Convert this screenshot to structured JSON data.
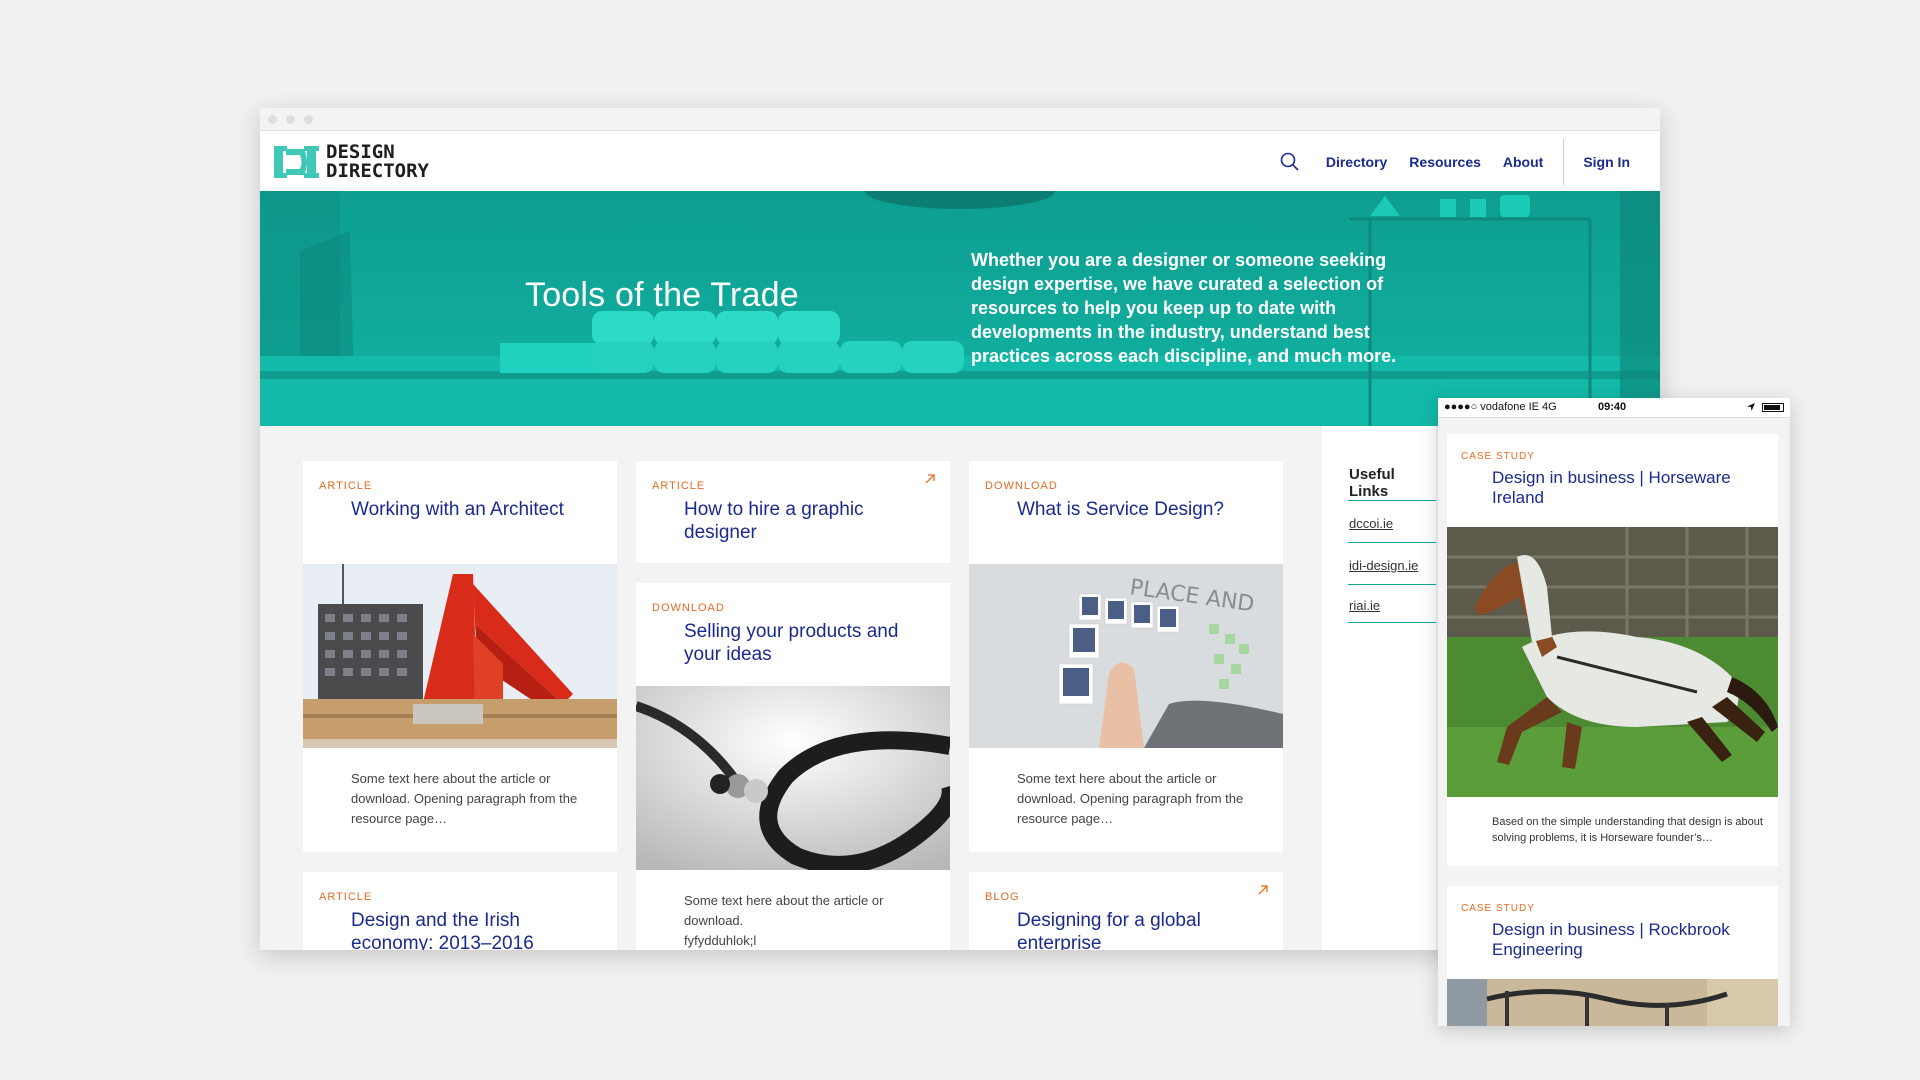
{
  "brand": {
    "logo_line1": "DESIGN",
    "logo_line2": "DIRECTORY",
    "accent": "#0fa596",
    "link_color": "#1b2a8f",
    "category_color": "#e56b21"
  },
  "nav": {
    "items": [
      "Directory",
      "Resources",
      "About"
    ],
    "sign_in": "Sign In"
  },
  "hero": {
    "title": "Tools of the Trade",
    "text": "Whether you are a designer or someone seeking design expertise, we have curated a selection of resources to help you keep up to date with developments in the industry, understand best practices across each discipline, and much more."
  },
  "cards": [
    {
      "category": "ARTICLE",
      "title": "Working with an Architect",
      "excerpt": "Some text here about the article or download. Opening paragraph from the resource page…",
      "image": "red-staircase-building-photo"
    },
    {
      "category": "ARTICLE",
      "title": "How to hire a graphic designer",
      "external": true
    },
    {
      "category": "DOWNLOAD",
      "title": "Selling your products and your ideas",
      "excerpt": "Some text here about the article or download.",
      "excerpt2": "fyfydduhlok;l",
      "image": "black-cord-necklace-photo"
    },
    {
      "category": "DOWNLOAD",
      "title": "What is Service Design?",
      "excerpt": "Some text here about the article or download. Opening paragraph from the resource page…",
      "image": "wall-sketches-photo"
    },
    {
      "category": "ARTICLE",
      "title": "Design and the Irish economy: 2013–2016"
    },
    {
      "category": "BLOG",
      "title": "Designing for a global enterprise",
      "external": true
    }
  ],
  "useful_links": {
    "heading": "Useful Links",
    "items": [
      "dccoi.ie",
      "idi-design.ie",
      "riai.ie"
    ]
  },
  "mobile": {
    "carrier": "●●●●○ vodafone IE   4G",
    "time": "09:40",
    "cards": [
      {
        "category": "CASE STUDY",
        "title": "Design in business | Horseware Ireland",
        "excerpt": "Based on the simple understanding that design is about solving problems, it is Horseware founder’s…",
        "image": "horse-running-photo"
      },
      {
        "category": "CASE STUDY",
        "title": "Design in business | Rockbrook Engineering"
      }
    ]
  }
}
